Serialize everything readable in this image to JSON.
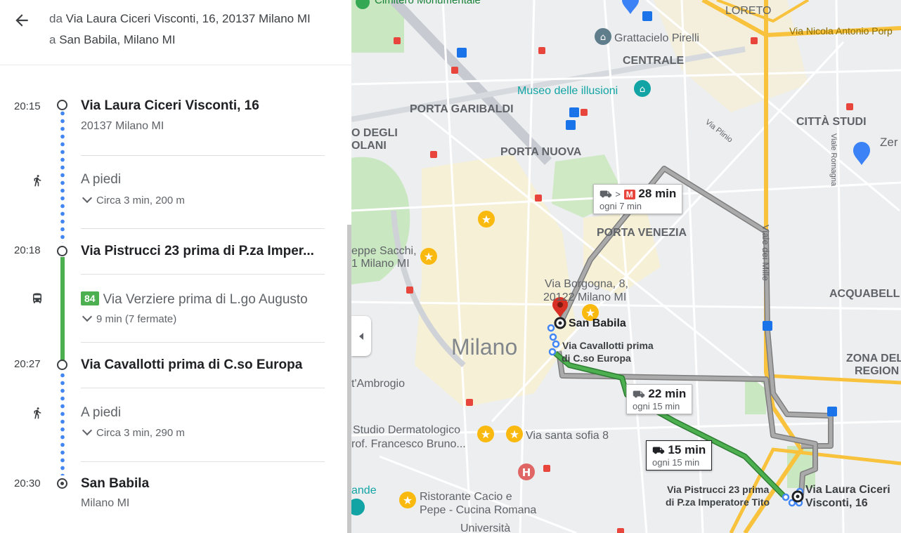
{
  "header": {
    "from_prefix": "da",
    "from": "Via Laura Ciceri Visconti, 16, 20137 Milano MI",
    "to_prefix": "a",
    "to": "San Babila, Milano MI"
  },
  "icons": {
    "back": "arrow-left-icon",
    "walk": "walk-icon",
    "bus": "bus-icon",
    "metro": "metro-icon",
    "pin": "red-pin-icon"
  },
  "colors": {
    "walk_dots": "#4285f4",
    "bus_line": "#4caf50",
    "alt_route": "#9e9e9e",
    "pin": "#d93025"
  },
  "itinerary": {
    "stop1": {
      "time": "20:15",
      "name": "Via Laura Ciceri Visconti, 16",
      "sub": "20137 Milano MI"
    },
    "walk1": {
      "title": "A piedi",
      "detail": "Circa 3 min, 200 m"
    },
    "stop2": {
      "time": "20:18",
      "name": "Via Pistrucci 23 prima di P.za Imper..."
    },
    "bus": {
      "line": "84",
      "title": "Via Verziere prima di L.go Augusto",
      "detail": "9 min (7 fermate)"
    },
    "stop3": {
      "time": "20:27",
      "name": "Via Cavallotti prima di C.so Europa"
    },
    "walk2": {
      "title": "A piedi",
      "detail": "Circa 3 min, 290 m"
    },
    "stop4": {
      "time": "20:30",
      "name": "San Babila",
      "sub": "Milano MI"
    }
  },
  "map": {
    "areas": [
      "LORETO",
      "CENTRALE",
      "PORTA GARIBALDI",
      "PORTA NUOVA",
      "PORTA VENEZIA",
      "CITTÀ STUDI",
      "ACQUABELL",
      "ZONA DEL",
      "REGION",
      "Milano"
    ],
    "pois": [
      "Cimitero Monumentale",
      "Grattacielo Pirelli",
      "Museo delle illusioni",
      "Via Nicola Antonio Porp",
      "Zer",
      "eppe Sacchi,",
      "1 Milano MI",
      "t'Ambrogio",
      "Studio Dermatologico",
      "rof. Francesco Bruno...",
      "Via santa sofia 8",
      "Ristorante Cacio e",
      "Pepe - Cucina Romana",
      "ande",
      "Università",
      "O DEGLI",
      "OLANI"
    ],
    "streets": [
      "Viale dei Mille",
      "Viale Romagna",
      "Via Plinio"
    ],
    "dest_label": "San Babila",
    "borgogna": [
      "Via Borgogna, 8,",
      "20122 Milano MI"
    ],
    "cavallotti": [
      "Via Cavallotti prima",
      "di C.so Europa"
    ],
    "pistrucci": [
      "Via Pistrucci 23 prima",
      "di P.za Imperatore Tito"
    ],
    "origin": [
      "Via Laura Ciceri",
      "Visconti, 16"
    ],
    "route_boxes": [
      {
        "time": "28 min",
        "freq": "ogni 7 min"
      },
      {
        "time": "22 min",
        "freq": "ogni 15 min"
      },
      {
        "time": "15 min",
        "freq": "ogni 15 min"
      }
    ]
  }
}
